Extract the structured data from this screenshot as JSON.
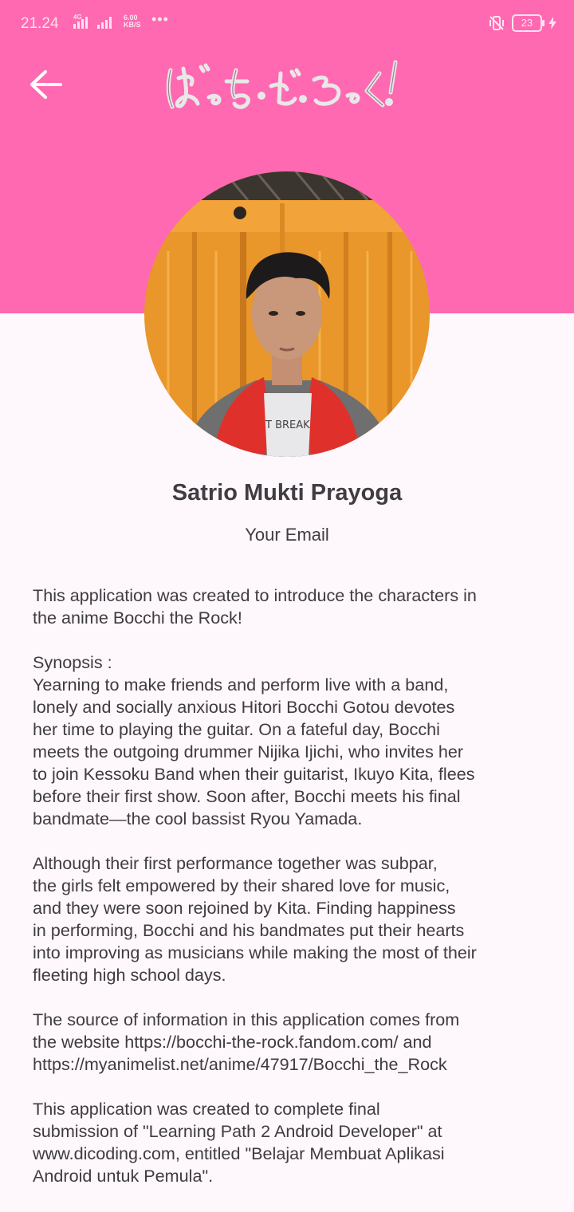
{
  "status_bar": {
    "time": "21.24",
    "network_type": "4G",
    "speed_value": "6.00",
    "speed_unit": "KB/S",
    "more": "•••",
    "battery": "23"
  },
  "header": {
    "logo_text": "ぼっち・ざ・ろっく!",
    "back_icon": "arrow-left-icon",
    "background_color": "#ff69b1"
  },
  "profile": {
    "name": "Satrio Mukti Prayoga",
    "email": "Your Email",
    "photo_shirt_text": "T BREAK"
  },
  "description": {
    "intro": [
      "This application was created to introduce the characters in",
      "the anime Bocchi the Rock!"
    ],
    "synopsis": [
      "Synopsis :",
      "Yearning to make friends and perform live with a band,",
      "lonely and socially anxious Hitori Bocchi Gotou devotes",
      "her time to playing the guitar. On a fateful day, Bocchi",
      "meets the outgoing drummer Nijika Ijichi, who invites her",
      "to join Kessoku Band when their guitarist, Ikuyo Kita, flees",
      "before their first show. Soon after, Bocchi meets his final",
      "bandmate—the cool bassist Ryou Yamada."
    ],
    "synopsis_2": [
      "Although their first performance together was subpar,",
      "the girls felt empowered by their shared love for music,",
      "and they were soon rejoined by Kita. Finding happiness",
      "in performing, Bocchi and his bandmates put their hearts",
      "into improving as musicians while making the most of their",
      "fleeting high school days."
    ],
    "source": [
      "The source of information in this application comes from",
      "the website https://bocchi-the-rock.fandom.com/ and",
      "https://myanimelist.net/anime/47917/Bocchi_the_Rock"
    ],
    "submission": [
      "This application was created to complete final",
      "submission of \"Learning Path 2 Android Developer\" at",
      "www.dicoding.com, entitled \"Belajar Membuat Aplikasi",
      "Android untuk Pemula\"."
    ]
  }
}
